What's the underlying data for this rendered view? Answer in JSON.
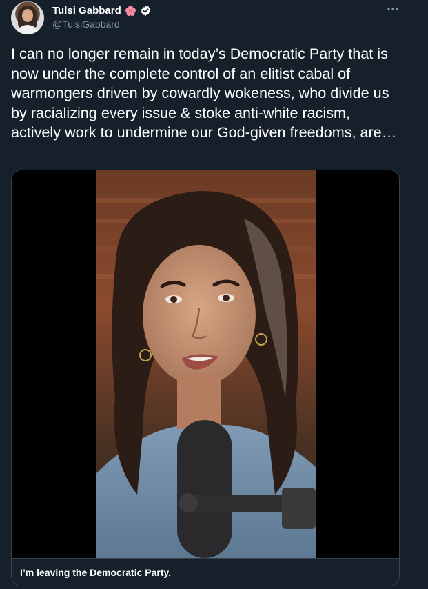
{
  "author": {
    "display_name": "Tulsi Gabbard",
    "handle": "@TulsiGabbard",
    "flower_emoji_icon": "hibiscus-icon",
    "verified_icon": "verified-badge-icon"
  },
  "tweet": {
    "text": "I can no longer remain in today’s Democratic Party that is now under the complete control of an elitist cabal of warmongers driven by cowardly wokeness, who divide us by racializing every issue & stoke anti-white racism, actively work to undermine our God-given freedoms, are…"
  },
  "media": {
    "caption": "I’m leaving the Democratic Party."
  },
  "colors": {
    "background": "#15202b",
    "border": "#38444d",
    "secondary_text": "#8899a6",
    "text": "#ffffff"
  }
}
